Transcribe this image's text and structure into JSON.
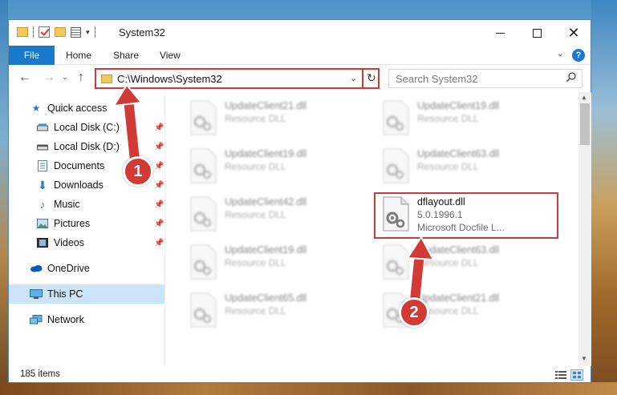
{
  "window": {
    "title": "System32",
    "minimize_label": "",
    "maximize_label": "",
    "close_label": "✕"
  },
  "ribbon": {
    "tabs": [
      "File",
      "Home",
      "Share",
      "View"
    ],
    "help_label": "?"
  },
  "address": {
    "path": "C:\\Windows\\System32"
  },
  "search": {
    "placeholder": "Search System32"
  },
  "sidebar": {
    "items": [
      {
        "label": "Quick access",
        "icon": "star-icon",
        "pinned": false
      },
      {
        "label": "Local Disk (C:)",
        "icon": "drive-icon",
        "pinned": true
      },
      {
        "label": "Local Disk (D:)",
        "icon": "drive-icon",
        "pinned": true
      },
      {
        "label": "Documents",
        "icon": "documents-icon",
        "pinned": true
      },
      {
        "label": "Downloads",
        "icon": "downloads-icon",
        "pinned": true
      },
      {
        "label": "Music",
        "icon": "music-icon",
        "pinned": true
      },
      {
        "label": "Pictures",
        "icon": "pictures-icon",
        "pinned": true
      },
      {
        "label": "Videos",
        "icon": "videos-icon",
        "pinned": true
      },
      {
        "label": "OneDrive",
        "icon": "onedrive-icon",
        "pinned": false
      },
      {
        "label": "This PC",
        "icon": "this-pc-icon",
        "pinned": false,
        "selected": true
      },
      {
        "label": "Network",
        "icon": "network-icon",
        "pinned": false
      }
    ]
  },
  "files": [
    {
      "name": "UpdateClient21.dll",
      "type": "Resource DLL",
      "blurred": true
    },
    {
      "name": "UpdateClient19.dll",
      "type": "Resource DLL",
      "blurred": true
    },
    {
      "name": "UpdateClient19.dll",
      "type": "Resource DLL",
      "blurred": true
    },
    {
      "name": "UpdateClient63.dll",
      "type": "Resource DLL",
      "blurred": true
    },
    {
      "name": "UpdateClient42.dll",
      "type": "Resource DLL",
      "blurred": true
    },
    {
      "name": "dflayout.dll",
      "version": "5.0.1996.1",
      "description": "Microsoft Docfile L...",
      "blurred": false
    },
    {
      "name": "UpdateClient19.dll",
      "type": "Resource DLL",
      "blurred": true
    },
    {
      "name": "UpdateClient63.dll",
      "type": "Resource DLL",
      "blurred": true
    },
    {
      "name": "UpdateClient65.dll",
      "type": "Resource DLL",
      "blurred": true
    },
    {
      "name": "UpdateClient21.dll",
      "type": "Resource DLL",
      "blurred": true
    }
  ],
  "status": {
    "item_count": "185 items"
  },
  "annotations": {
    "step1": "1",
    "step2": "2",
    "color": "#d23a36"
  }
}
